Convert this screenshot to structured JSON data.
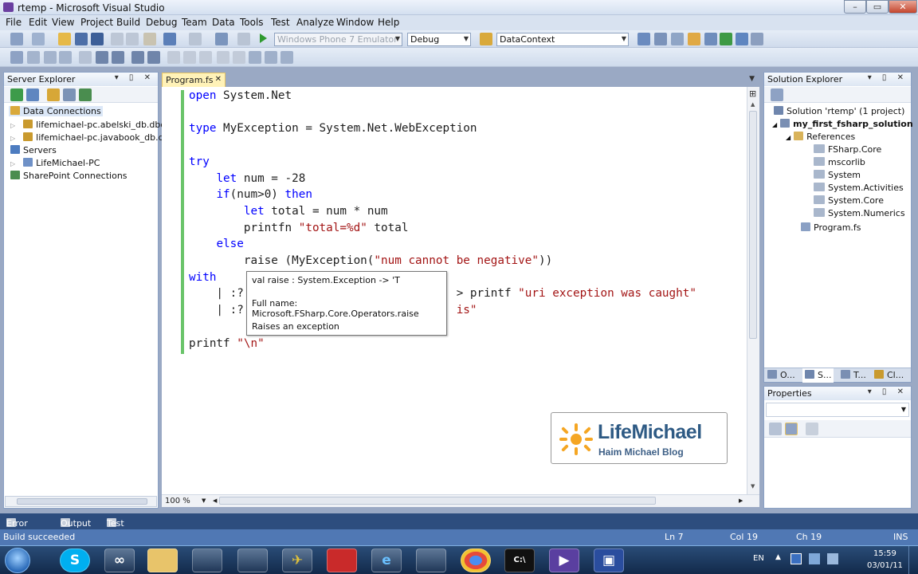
{
  "window": {
    "title": "rtemp - Microsoft Visual Studio",
    "controls": {
      "minimize": "–",
      "restore": "▭",
      "close": "✕"
    }
  },
  "menu": [
    "File",
    "Edit",
    "View",
    "Project",
    "Build",
    "Debug",
    "Team",
    "Data",
    "Tools",
    "Test",
    "Analyze",
    "Window",
    "Help"
  ],
  "toolbar": {
    "target": "Windows Phone 7 Emulator",
    "config": "Debug",
    "datacontext": "DataContext"
  },
  "server_explorer": {
    "title": "Server Explorer",
    "items": [
      {
        "label": "Data Connections",
        "level": 0
      },
      {
        "label": "lifemichael-pc.abelski_db.dbo",
        "level": 1
      },
      {
        "label": "lifemichael-pc.javabook_db.dbo",
        "level": 1
      },
      {
        "label": "Servers",
        "level": 0
      },
      {
        "label": "LifeMichael-PC",
        "level": 1
      },
      {
        "label": "SharePoint Connections",
        "level": 0
      }
    ]
  },
  "editor": {
    "tab": "Program.fs",
    "zoom": "100 %",
    "lines": [
      [
        {
          "t": "open",
          "k": "kw"
        },
        {
          "t": " System.Net"
        }
      ],
      [],
      [
        {
          "t": "type",
          "k": "kw"
        },
        {
          "t": " MyException = System.Net.WebException"
        }
      ],
      [],
      [
        {
          "t": "try",
          "k": "kw"
        }
      ],
      [
        {
          "t": "    "
        },
        {
          "t": "let",
          "k": "kw"
        },
        {
          "t": " num = -28"
        }
      ],
      [
        {
          "t": "    "
        },
        {
          "t": "if",
          "k": "kw"
        },
        {
          "t": "(num>0) "
        },
        {
          "t": "then",
          "k": "kw"
        }
      ],
      [
        {
          "t": "        "
        },
        {
          "t": "let",
          "k": "kw"
        },
        {
          "t": " total = num * num"
        }
      ],
      [
        {
          "t": "        printfn "
        },
        {
          "t": "\"total=%d\"",
          "k": "str"
        },
        {
          "t": " total"
        }
      ],
      [
        {
          "t": "    "
        },
        {
          "t": "else",
          "k": "kw"
        }
      ],
      [
        {
          "t": "        raise (MyException("
        },
        {
          "t": "\"num cannot be negative\"",
          "k": "str"
        },
        {
          "t": "))"
        }
      ],
      [
        {
          "t": "with",
          "k": "kw"
        }
      ],
      [
        {
          "t": "    | :?                               > printf "
        },
        {
          "t": "\"uri exception was caught\"",
          "k": "str"
        }
      ],
      [
        {
          "t": "    | :?                               "
        },
        {
          "t": "is\"",
          "k": "str"
        }
      ],
      [],
      [
        {
          "t": "printf "
        },
        {
          "t": "\"\\n\"",
          "k": "str"
        }
      ]
    ]
  },
  "tooltip": {
    "signature": "val raise : System.Exception -> 'T",
    "fullname": "Full name: Microsoft.FSharp.Core.Operators.raise",
    "description": "Raises an exception"
  },
  "logo": {
    "name": "LifeMichael",
    "subtitle": "Haim Michael Blog"
  },
  "solution_explorer": {
    "title": "Solution Explorer",
    "items": [
      {
        "label": "Solution 'rtemp' (1 project)",
        "level": 0,
        "bold": false
      },
      {
        "label": "my_first_fsharp_solution",
        "level": 1,
        "bold": true
      },
      {
        "label": "References",
        "level": 2,
        "bold": false
      },
      {
        "label": "FSharp.Core",
        "level": 3,
        "bold": false
      },
      {
        "label": "mscorlib",
        "level": 3,
        "bold": false
      },
      {
        "label": "System",
        "level": 3,
        "bold": false
      },
      {
        "label": "System.Activities",
        "level": 3,
        "bold": false
      },
      {
        "label": "System.Core",
        "level": 3,
        "bold": false
      },
      {
        "label": "System.Numerics",
        "level": 3,
        "bold": false
      },
      {
        "label": "Program.fs",
        "level": 2,
        "bold": false
      }
    ],
    "tabs": [
      "O...",
      "S...",
      "T...",
      "Cl..."
    ]
  },
  "properties": {
    "title": "Properties"
  },
  "bottom_tabs": [
    "Error List",
    "Output",
    "Test Results"
  ],
  "status": {
    "message": "Build succeeded",
    "line": "Ln 7",
    "col": "Col 19",
    "ch": "Ch 19",
    "mode": "INS"
  },
  "taskbar": {
    "lang": "EN",
    "time": "15:59",
    "date": "03/01/11"
  }
}
